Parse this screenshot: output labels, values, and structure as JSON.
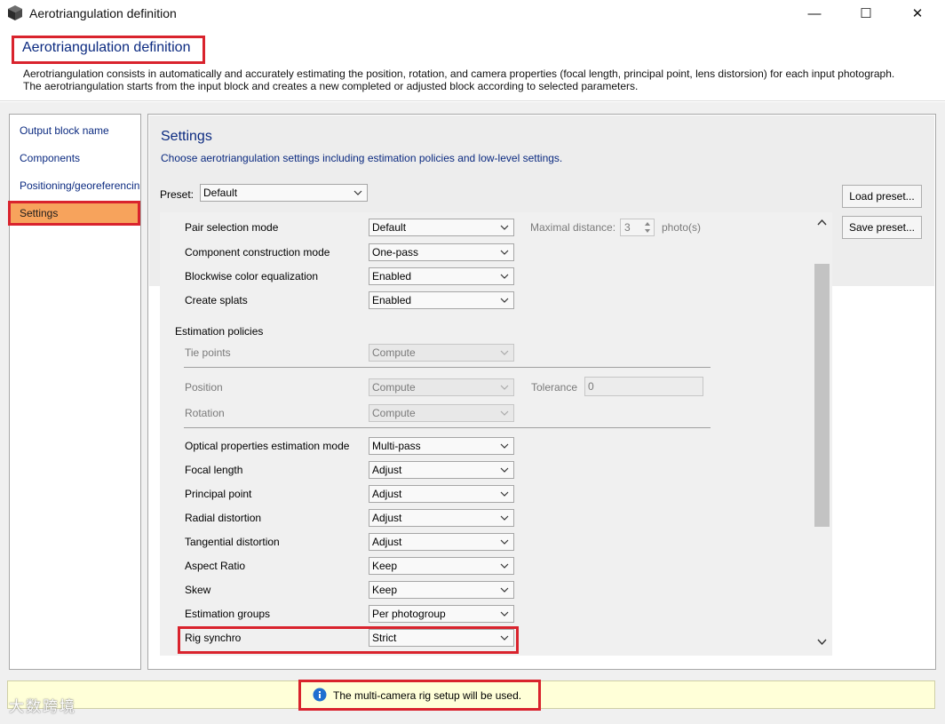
{
  "window": {
    "title": "Aerotriangulation definition",
    "controls": [
      "—",
      "☐",
      "✕"
    ]
  },
  "header": {
    "title": "Aerotriangulation definition",
    "description_line1": "Aerotriangulation consists in automatically and accurately estimating the position, rotation, and camera properties (focal length, principal point, lens distorsion) for each input photograph.",
    "description_line2": "The aerotriangulation starts from the input block and creates a new completed or adjusted block according to selected parameters."
  },
  "nav": {
    "items": [
      {
        "label": "Output block name",
        "active": false
      },
      {
        "label": "Components",
        "active": false
      },
      {
        "label": "Positioning/georeferencing",
        "active": false
      },
      {
        "label": "Settings",
        "active": true
      }
    ]
  },
  "settings": {
    "title": "Settings",
    "description": "Choose aerotriangulation settings including estimation policies and low-level settings.",
    "preset_label": "Preset:",
    "preset_value": "Default",
    "load_preset": "Load preset...",
    "save_preset": "Save preset...",
    "rows_top": [
      {
        "label": "Pair selection mode",
        "value": "Default"
      },
      {
        "label": "Component construction mode",
        "value": "One-pass"
      },
      {
        "label": "Blockwise color equalization",
        "value": "Enabled"
      },
      {
        "label": "Create splats",
        "value": "Enabled"
      }
    ],
    "max_distance_label": "Maximal distance:",
    "max_distance_value": "3",
    "max_distance_unit": "photo(s)",
    "estimation_policies_label": "Estimation policies",
    "tie_points": {
      "label": "Tie points",
      "value": "Compute"
    },
    "position": {
      "label": "Position",
      "value": "Compute"
    },
    "rotation": {
      "label": "Rotation",
      "value": "Compute"
    },
    "tolerance_label": "Tolerance",
    "tolerance_value": "0",
    "rows_bottom": [
      {
        "label": "Optical properties estimation mode",
        "value": "Multi-pass"
      },
      {
        "label": "Focal length",
        "value": "Adjust"
      },
      {
        "label": "Principal point",
        "value": "Adjust"
      },
      {
        "label": "Radial distortion",
        "value": "Adjust"
      },
      {
        "label": "Tangential distortion",
        "value": "Adjust"
      },
      {
        "label": "Aspect Ratio",
        "value": "Keep"
      },
      {
        "label": "Skew",
        "value": "Keep"
      },
      {
        "label": "Estimation groups",
        "value": "Per photogroup"
      },
      {
        "label": "Rig synchro",
        "value": "Strict"
      }
    ]
  },
  "status": {
    "message": "The multi-camera rig setup will be used.",
    "watermark": "大数跨境"
  },
  "colors": {
    "accent_red": "#d9232d",
    "title_blue": "#0b2a80",
    "active_nav": "#f7a35c",
    "status_bg": "#ffffd8"
  }
}
